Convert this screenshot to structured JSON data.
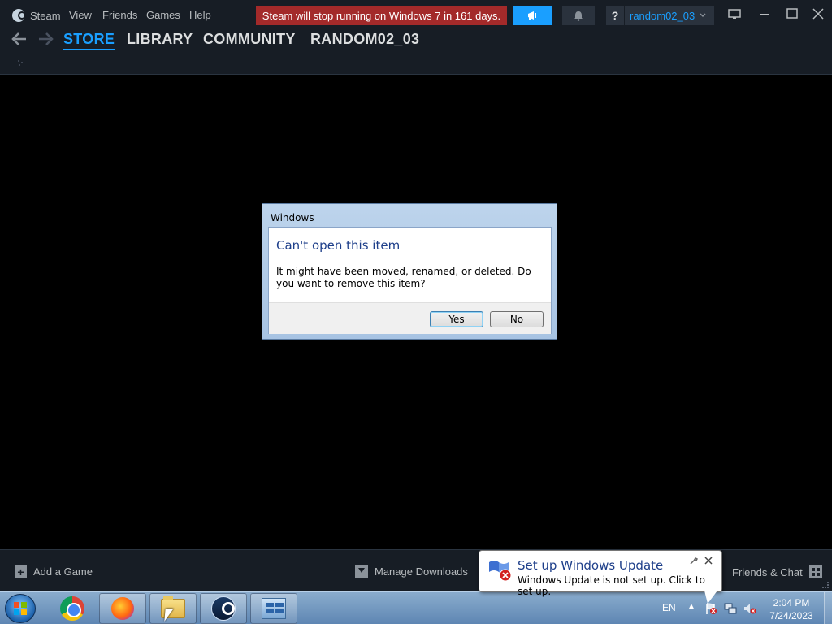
{
  "menubar": {
    "steam_label": "Steam",
    "view_label": "View",
    "friends_label": "Friends",
    "games_label": "Games",
    "help_label": "Help",
    "warning_banner": "Steam will stop running on Windows 7 in 161 days.",
    "help_button": "?",
    "account_name": "random02_03"
  },
  "nav": {
    "tabs": [
      {
        "label": "STORE"
      },
      {
        "label": "LIBRARY"
      },
      {
        "label": "COMMUNITY"
      },
      {
        "label": "RANDOM02_03"
      }
    ]
  },
  "bottom_bar": {
    "add_game": "Add a Game",
    "manage_downloads": "Manage Downloads",
    "friends_chat": "Friends & Chat"
  },
  "dialog": {
    "window_title": "Windows",
    "heading": "Can't open this item",
    "message": "It might have been moved, renamed, or deleted. Do you want to remove this item?",
    "yes_label": "Yes",
    "no_label": "No"
  },
  "balloon": {
    "title": "Set up Windows Update",
    "text": "Windows Update is not set up. Click to set up."
  },
  "taskbar": {
    "language": "EN",
    "time": "2:04 PM",
    "date": "7/24/2023"
  },
  "colors": {
    "steam_bg": "#171d25",
    "accent_blue": "#1a9fff",
    "warning_red": "#a32a2a",
    "dialog_heading": "#1e3f8a"
  }
}
